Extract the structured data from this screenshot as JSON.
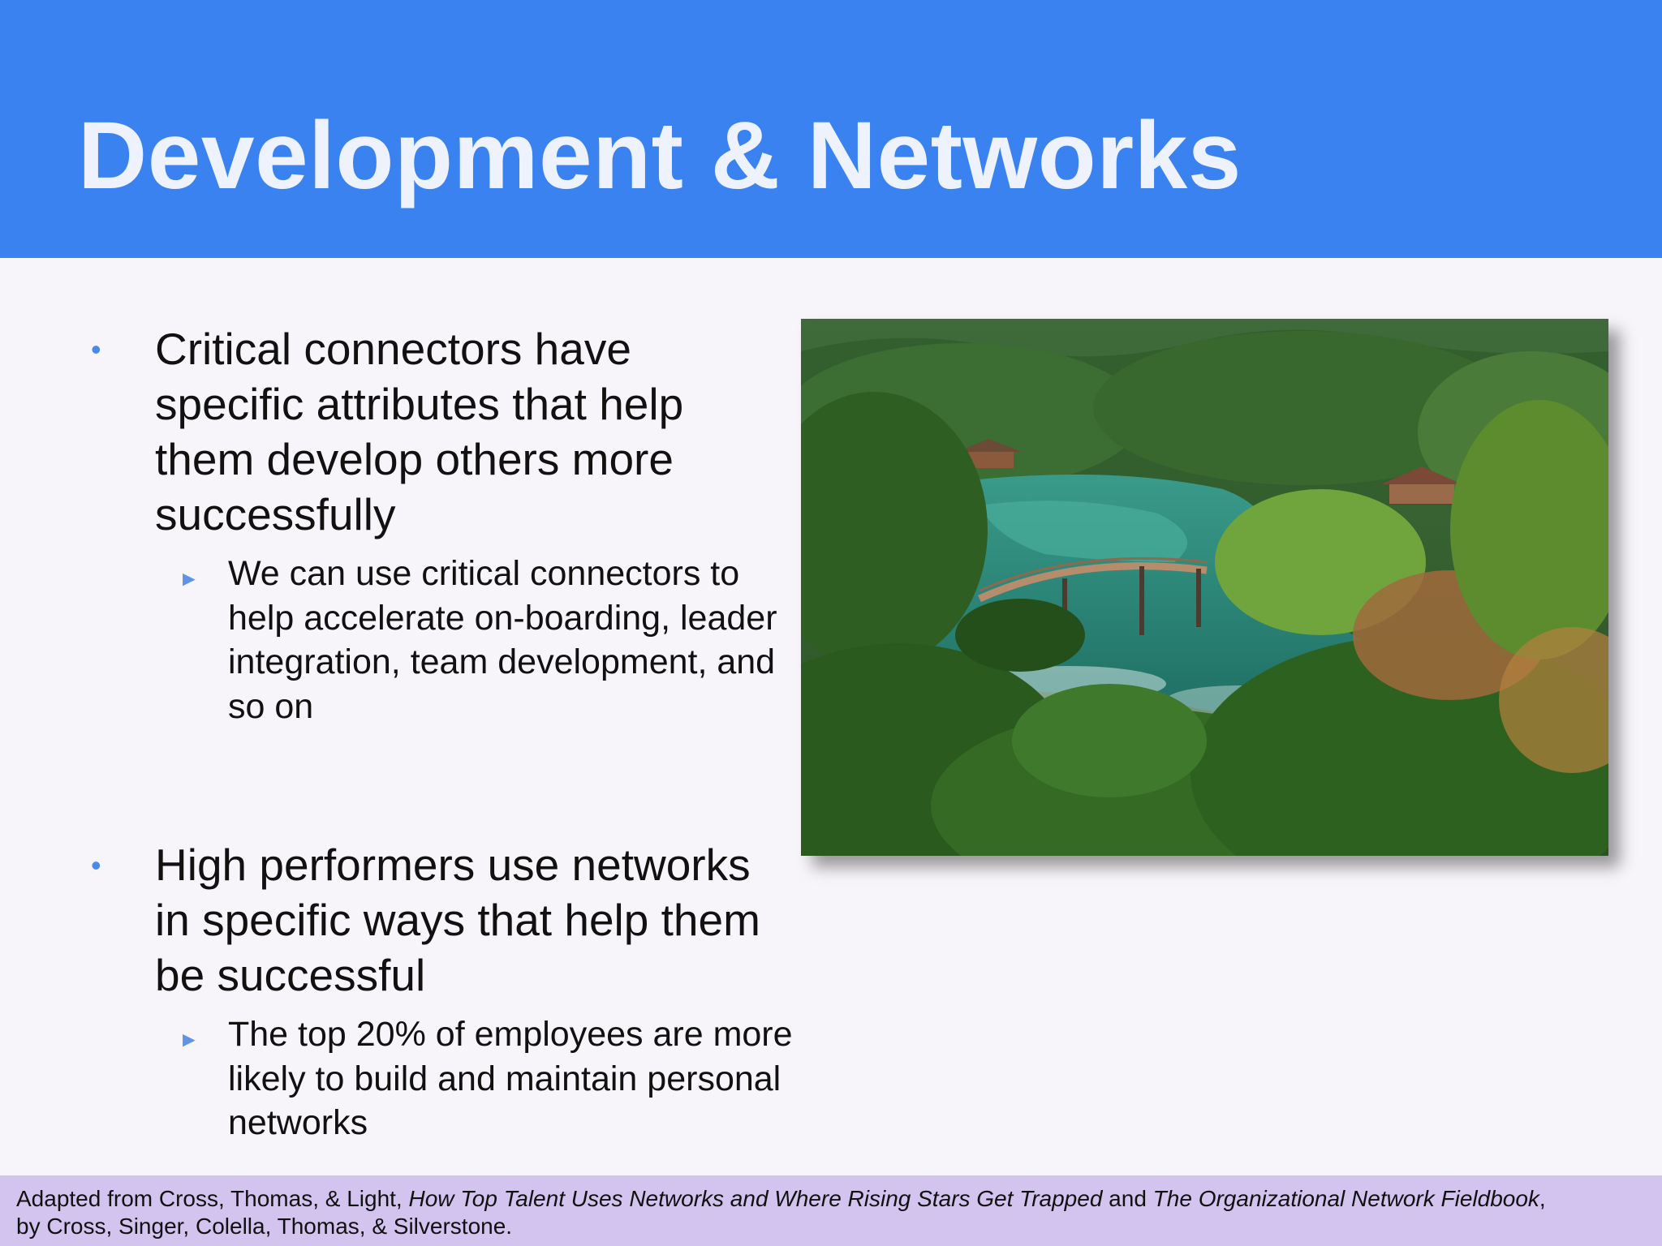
{
  "slide": {
    "title": "Development & Networks"
  },
  "bullets": [
    {
      "text": "Critical connectors have specific attributes that help them develop others more successfully",
      "sub": "We can use critical connectors to help accelerate on-boarding, leader integration, team development, and so on"
    },
    {
      "text": "High performers use networks in specific ways that help them be successful",
      "sub": "The top 20% of employees are more likely to build and maintain personal networks"
    }
  ],
  "footer": {
    "prefix": "Adapted from Cross, Thomas, & Light, ",
    "title1": "How Top Talent  Uses Networks and Where Rising Stars Get Trapped",
    "middle": " and ",
    "title2": "The Organizational Network Fieldbook",
    "suffix": ", by Cross, Singer, Colella, Thomas, & Silverstone."
  },
  "colors": {
    "header": "#3b82f1",
    "footer": "#d2c4ee",
    "bullet": "#4a8ae8",
    "background": "#f7f5f9"
  }
}
